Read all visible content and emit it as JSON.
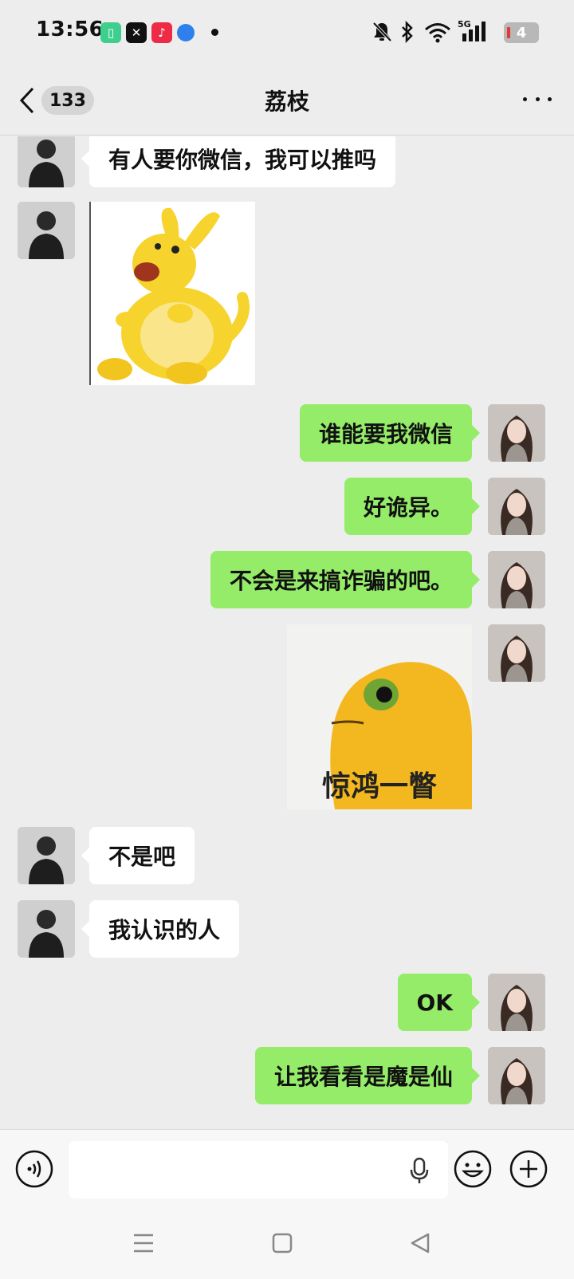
{
  "status_bar": {
    "time": "13:56",
    "network": "5G",
    "battery": "4",
    "app_badges": [
      {
        "name": "battery-app-icon",
        "color": "#3ecf8e"
      },
      {
        "name": "capcut-icon",
        "color": "#111111"
      },
      {
        "name": "music-icon",
        "color": "#ee2b47"
      },
      {
        "name": "browser-icon",
        "color": "#2f80ed"
      }
    ]
  },
  "header": {
    "unread_count": "133",
    "title": "荔枝"
  },
  "messages": [
    {
      "side": "in",
      "type": "text",
      "text": "有人要你微信，我可以推吗"
    },
    {
      "side": "in",
      "type": "sticker",
      "sticker": "yellow-kangaroo-toy"
    },
    {
      "side": "out",
      "type": "text",
      "text": "谁能要我微信"
    },
    {
      "side": "out",
      "type": "text",
      "text": "好诡异。"
    },
    {
      "side": "out",
      "type": "text",
      "text": "不会是来搞诈骗的吧。"
    },
    {
      "side": "out",
      "type": "sticker",
      "sticker": "yellow-bird-glance",
      "caption": "惊鸿一瞥"
    },
    {
      "side": "in",
      "type": "text",
      "text": "不是吧"
    },
    {
      "side": "in",
      "type": "text",
      "text": "我认识的人"
    },
    {
      "side": "out",
      "type": "text",
      "text": "OK"
    },
    {
      "side": "out",
      "type": "text",
      "text": "让我看看是魔是仙"
    }
  ],
  "input_bar": {
    "placeholder": ""
  },
  "colors": {
    "outgoing_bubble": "#95ec69",
    "incoming_bubble": "#ffffff",
    "chat_background": "#ededed"
  }
}
